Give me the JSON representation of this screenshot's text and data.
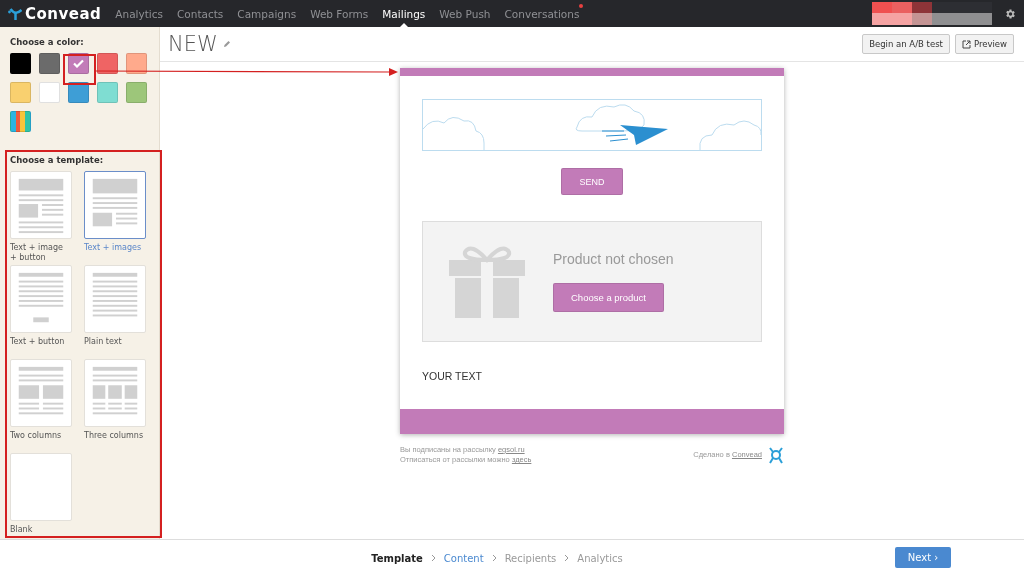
{
  "navbar": {
    "logo": "Convead",
    "items": [
      {
        "label": "Analytics",
        "selected": false,
        "badge": false
      },
      {
        "label": "Contacts",
        "selected": false,
        "badge": false
      },
      {
        "label": "Campaigns",
        "selected": false,
        "badge": false
      },
      {
        "label": "Web Forms",
        "selected": false,
        "badge": false
      },
      {
        "label": "Mailings",
        "selected": true,
        "badge": false
      },
      {
        "label": "Web Push",
        "selected": false,
        "badge": false
      },
      {
        "label": "Conversations",
        "selected": false,
        "badge": true
      }
    ]
  },
  "sidebar": {
    "color_heading": "Choose a color:",
    "colors": [
      {
        "kind": "plain",
        "color": "#000000",
        "selected": false
      },
      {
        "kind": "plain",
        "color": "#6b6b6b",
        "selected": false
      },
      {
        "kind": "plain",
        "color": "#c27bb8",
        "selected": true
      },
      {
        "kind": "plain",
        "color": "#ef6464",
        "selected": false
      },
      {
        "kind": "plain",
        "color": "#ffaa8c",
        "selected": false
      },
      {
        "kind": "plain",
        "color": "#f9d06f",
        "selected": false
      },
      {
        "kind": "plain",
        "color": "#ffffff",
        "selected": false
      },
      {
        "kind": "plain",
        "color": "#3e9ed6",
        "selected": false
      },
      {
        "kind": "plain",
        "color": "#7fddd2",
        "selected": false
      },
      {
        "kind": "plain",
        "color": "#9dc67a",
        "selected": false
      },
      {
        "kind": "rainbow",
        "selected": false
      }
    ],
    "template_heading": "Choose a template:",
    "templates": [
      {
        "kind": "text-image-button",
        "label": "Text + image + button",
        "selected": false
      },
      {
        "kind": "text-images",
        "label": "Text + images",
        "selected": true
      },
      {
        "kind": "text-button",
        "label": "Text + button",
        "selected": false
      },
      {
        "kind": "plain-text",
        "label": "Plain text",
        "selected": false
      },
      {
        "kind": "two-columns",
        "label": "Two columns",
        "selected": false
      },
      {
        "kind": "three-columns",
        "label": "Three columns",
        "selected": false
      },
      {
        "kind": "blank",
        "label": "Blank",
        "selected": false
      }
    ]
  },
  "header": {
    "title": "NEW",
    "buttons": [
      {
        "kind": "plain",
        "label": "Begin an A/B test"
      },
      {
        "kind": "external",
        "label": "Preview"
      }
    ]
  },
  "email": {
    "send_button": "SEND",
    "product_title": "Product not chosen",
    "product_button": "Choose a product",
    "body_text": "YOUR TEXT",
    "footer_left": [
      {
        "text": "Вы подписаны на рассылку",
        "link": "egsol.ru"
      },
      {
        "text": "Отписаться от рассылки можно",
        "link": "здесь"
      }
    ],
    "footer_right": {
      "text": "Сделано в",
      "link": "Convead"
    }
  },
  "steps": [
    {
      "label": "Template",
      "kind": "current"
    },
    {
      "label": "Content",
      "kind": "link"
    },
    {
      "label": "Recipients",
      "kind": "pending"
    },
    {
      "label": "Analytics",
      "kind": "pending"
    }
  ],
  "next_button": "Next ›"
}
